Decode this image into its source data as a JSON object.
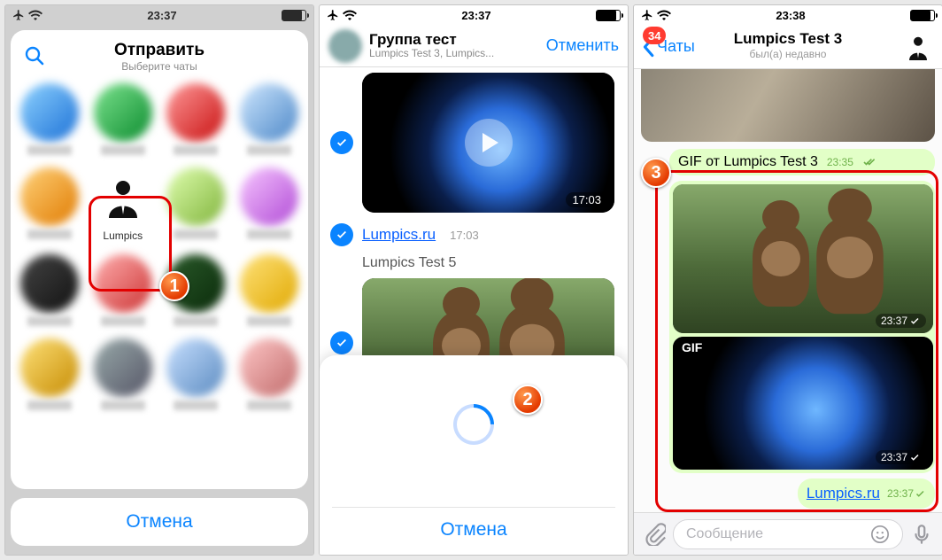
{
  "statusbar": {
    "time1": "23:37",
    "time2": "23:37",
    "time3": "23:38"
  },
  "panel1": {
    "title": "Отправить",
    "subtitle": "Выберите чаты",
    "lumpics_label": "Lumpics",
    "cancel": "Отмена"
  },
  "panel2": {
    "nav_title": "Группа тест",
    "nav_sub": "Lumpics Test 3, Lumpics...",
    "nav_cancel": "Отменить",
    "video_time": "17:03",
    "link_text": "Lumpics.ru",
    "link_time": "17:03",
    "msg_name": "Lumpics Test 5",
    "cancel": "Отмена"
  },
  "panel3": {
    "back_label": "Чаты",
    "badge": "34",
    "nav_title": "Lumpics Test 3",
    "nav_sub": "был(а) недавно",
    "gif_caption": "GIF от Lumpics Test 3",
    "gif_caption_time": "23:35",
    "gif_tag": "GIF",
    "img1_time": "23:37",
    "img2_time": "23:37",
    "link_text": "Lumpics.ru",
    "link_time": "23:37",
    "composer_placeholder": "Сообщение"
  },
  "colors": {
    "accent": "#0a84ff",
    "danger": "#ff3b30",
    "bubble": "#e2ffc7",
    "highlight": "#e30000"
  }
}
